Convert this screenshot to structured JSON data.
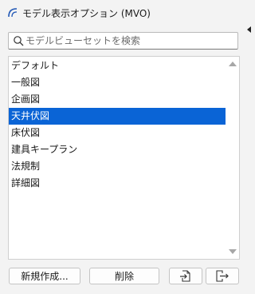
{
  "window": {
    "title": "モデル表示オプション (MVO)"
  },
  "search": {
    "placeholder": "モデルビューセットを検索",
    "value": ""
  },
  "list": {
    "items": [
      {
        "label": "デフォルト",
        "selected": false
      },
      {
        "label": "一般図",
        "selected": false
      },
      {
        "label": "企画図",
        "selected": false
      },
      {
        "label": "天井伏図",
        "selected": true
      },
      {
        "label": "床伏図",
        "selected": false
      },
      {
        "label": "建具キープラン",
        "selected": false
      },
      {
        "label": "法規制",
        "selected": false
      },
      {
        "label": "詳細図",
        "selected": false
      }
    ]
  },
  "buttons": {
    "new_label": "新規作成...",
    "delete_label": "削除",
    "import_icon": "import-icon",
    "export_icon": "export-icon"
  },
  "colors": {
    "selection": "#0a64d6",
    "background": "#f3f3f3"
  }
}
